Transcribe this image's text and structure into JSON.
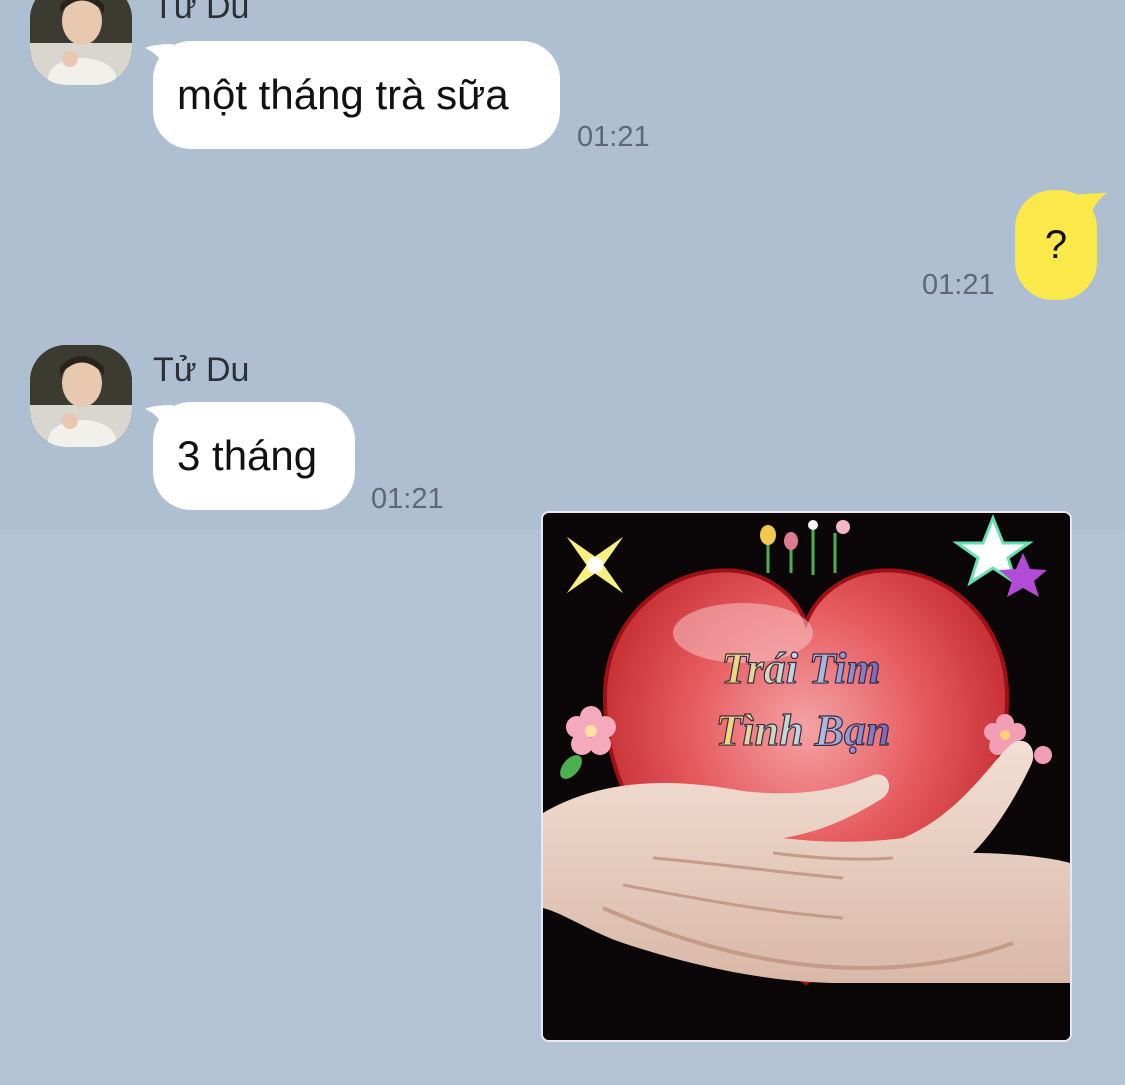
{
  "messages": [
    {
      "sender": "Tử Du",
      "text": "một tháng trà sữa",
      "time": "01:21"
    },
    {
      "sender": "",
      "text": "?",
      "time": "01:21"
    },
    {
      "sender": "Tử Du",
      "text": "3 tháng",
      "time": "01:21"
    }
  ],
  "sticker": {
    "line1": "Trái Tim",
    "line2": "Tình Bạn"
  },
  "colors": {
    "background": "#aebfd2",
    "incoming_bubble": "#ffffff",
    "outgoing_bubble": "#fbe84a"
  }
}
